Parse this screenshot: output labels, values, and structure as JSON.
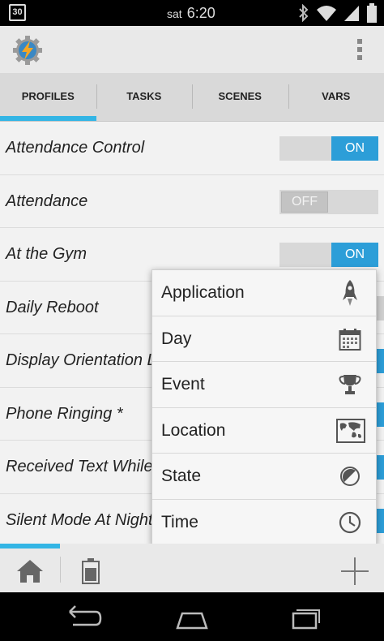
{
  "status_bar": {
    "calendar_day": "30",
    "day": "sat",
    "time": "6:20",
    "icons": [
      "bluetooth-icon",
      "wifi-icon",
      "signal-icon",
      "battery-icon"
    ]
  },
  "header": {
    "logo": "tasker-logo-icon",
    "overflow": "overflow-menu-icon"
  },
  "tabs": [
    {
      "label": "PROFILES",
      "active": true
    },
    {
      "label": "TASKS",
      "active": false
    },
    {
      "label": "SCENES",
      "active": false
    },
    {
      "label": "VARS",
      "active": false
    }
  ],
  "profiles": [
    {
      "name": "Attendance Control",
      "toggle": "ON"
    },
    {
      "name": "Attendance",
      "toggle": "OFF"
    },
    {
      "name": "At the Gym",
      "toggle": "ON"
    },
    {
      "name": "Daily Reboot",
      "toggle": ""
    },
    {
      "name": "Display Orientation L",
      "toggle": ""
    },
    {
      "name": "Phone Ringing *",
      "toggle": ""
    },
    {
      "name": "Received Text While",
      "toggle": ""
    },
    {
      "name": "Silent Mode At Night",
      "toggle": ""
    }
  ],
  "popup_menu": {
    "items": [
      {
        "label": "Application",
        "icon": "rocket-icon"
      },
      {
        "label": "Day",
        "icon": "calendar-icon"
      },
      {
        "label": "Event",
        "icon": "trophy-icon"
      },
      {
        "label": "Location",
        "icon": "map-icon"
      },
      {
        "label": "State",
        "icon": "half-circle-icon"
      },
      {
        "label": "Time",
        "icon": "clock-icon"
      }
    ]
  },
  "bottom_bar": {
    "home": "home-icon",
    "battery": "battery-icon",
    "add": "add-icon"
  },
  "nav_bar": [
    "back-icon",
    "home-icon",
    "recent-apps-icon"
  ],
  "colors": {
    "accent": "#33b5e5",
    "toggle_on": "#2c9ed8",
    "background": "#f2f2f2"
  }
}
